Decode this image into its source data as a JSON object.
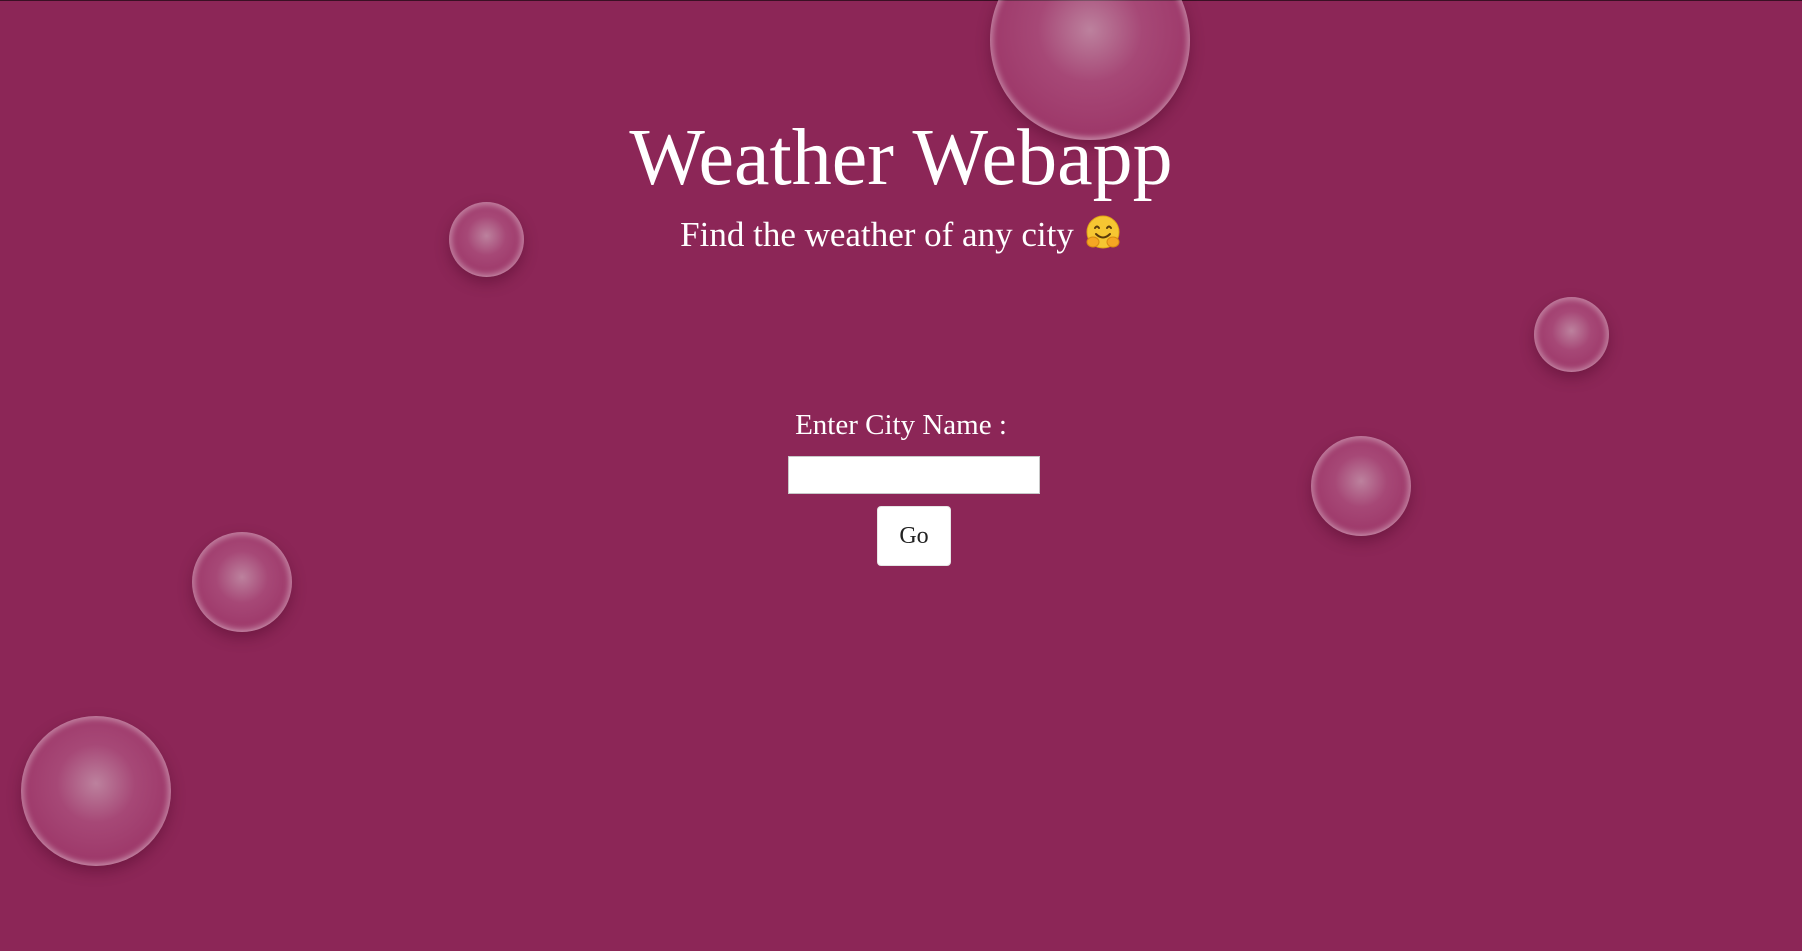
{
  "page": {
    "title": "Weather Webapp",
    "subtitle": "Find the weather of any city",
    "subtitle_emoji": "hugging-face-emoji",
    "background_color": "#8c2657"
  },
  "form": {
    "label": "Enter City Name :",
    "input_value": "",
    "input_placeholder": "",
    "submit_label": "Go"
  }
}
